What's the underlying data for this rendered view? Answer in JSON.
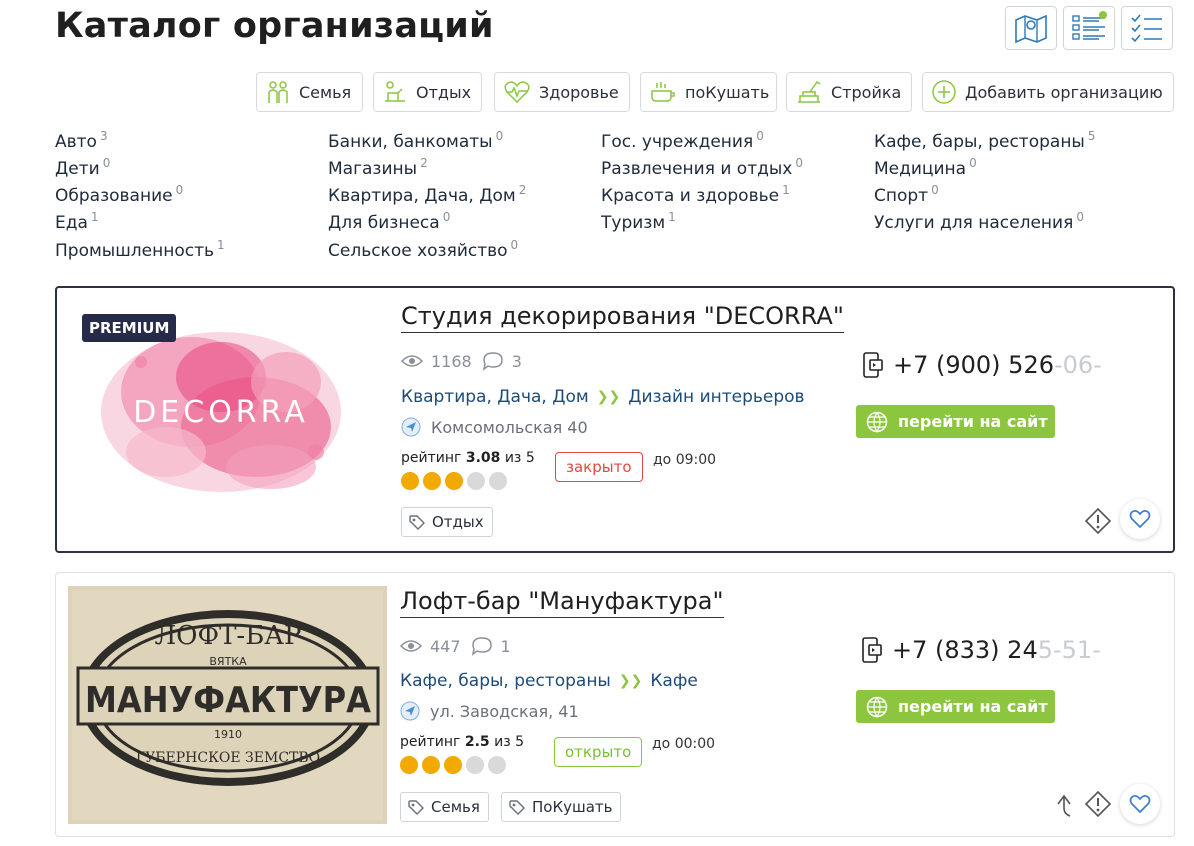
{
  "page": {
    "title": "Каталог организаций"
  },
  "view_buttons": [
    {
      "name": "map-view-button",
      "icon": "map-icon"
    },
    {
      "name": "list-view-button",
      "icon": "list-view-icon"
    },
    {
      "name": "checklist-view-button",
      "icon": "checklist-icon"
    }
  ],
  "categories": [
    {
      "label": "Семья",
      "icon": "family-icon"
    },
    {
      "label": "Отдых",
      "icon": "rest-icon"
    },
    {
      "label": "Здоровье",
      "icon": "health-icon"
    },
    {
      "label": "поКушать",
      "icon": "food-icon"
    },
    {
      "label": "Стройка",
      "icon": "construction-icon"
    },
    {
      "label": "Добавить организацию",
      "icon": "add-icon"
    }
  ],
  "rubrics": [
    {
      "label": "Авто",
      "count": "3"
    },
    {
      "label": "Дети",
      "count": "0"
    },
    {
      "label": "Образование",
      "count": "0"
    },
    {
      "label": "Еда",
      "count": "1"
    },
    {
      "label": "Промышленность",
      "count": "1"
    },
    {
      "label": "Банки, банкоматы",
      "count": "0"
    },
    {
      "label": "Магазины",
      "count": "2"
    },
    {
      "label": "Квартира, Дача, Дом",
      "count": "2"
    },
    {
      "label": "Для бизнеса",
      "count": "0"
    },
    {
      "label": "Сельское хозяйство",
      "count": "0"
    },
    {
      "label": "Гос. учреждения",
      "count": "0"
    },
    {
      "label": "Развлечения и отдых",
      "count": "0"
    },
    {
      "label": "Красота и здоровье",
      "count": "1"
    },
    {
      "label": "Туризм",
      "count": "1"
    },
    {
      "label": "Кафе, бары, рестораны",
      "count": "5"
    },
    {
      "label": "Медицина",
      "count": "0"
    },
    {
      "label": "Спорт",
      "count": "0"
    },
    {
      "label": "Услуги для населения",
      "count": "0"
    }
  ],
  "organizations": [
    {
      "badge": "PREMIUM",
      "name": "Студия декорирования \"DECORRA\"",
      "image_text": "DECORRA",
      "views": "1168",
      "comments": "3",
      "category": "Квартира, Дача, Дом",
      "subcategory": "Дизайн интерьеров",
      "address": "Комсомольская 40",
      "rating_prefix": "рейтинг",
      "rating_value": "3.08",
      "rating_suffix": "из 5",
      "rating_filled": 3,
      "rating_total": 5,
      "status": "закрыто",
      "hours": "до 09:00",
      "tags": [
        "Отдых"
      ],
      "phone_visible": "+7 (900) 526",
      "phone_faded": "-06-",
      "site_button": "перейти на сайт"
    },
    {
      "badge": "",
      "name": "Лофт-бар \"Мануфактура\"",
      "image_text": "МАНУФАКТУРА",
      "image_top_text": "ЛОФТ-БАР",
      "image_city": "ВЯТКА",
      "image_year": "1910",
      "image_bottom_text": "ГУБЕРНСКОЕ ЗЕМСТВО",
      "views": "447",
      "comments": "1",
      "category": "Кафе, бары, рестораны",
      "subcategory": "Кафе",
      "address": "ул. Заводская, 41",
      "rating_prefix": "рейтинг",
      "rating_value": "2.5",
      "rating_suffix": "из 5",
      "rating_filled": 3,
      "rating_total": 5,
      "status": "открыто",
      "hours": "до 00:00",
      "tags": [
        "Семья",
        "ПоКушать"
      ],
      "phone_visible": "+7 (833) 24",
      "phone_faded": "5-51-",
      "site_button": "перейти на сайт"
    }
  ],
  "colors": {
    "accent_green": "#8cc63f",
    "link_blue": "#1e4a78",
    "badge_navy": "#252b48",
    "star_on": "#f2a900",
    "star_off": "#d9d9d9",
    "closed_red": "#e04a3f"
  }
}
